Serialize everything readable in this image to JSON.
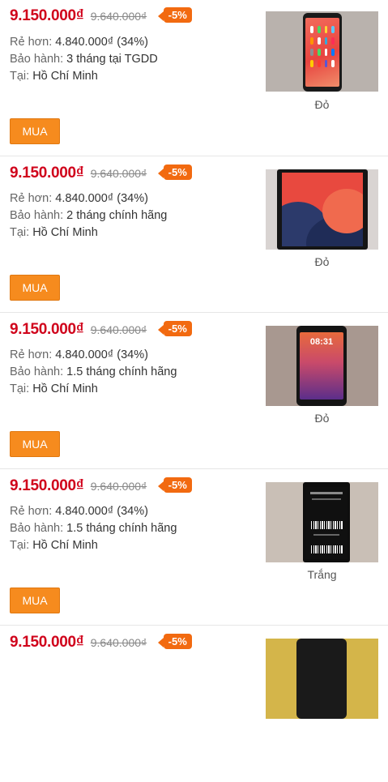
{
  "labels": {
    "cheaper": "Rẻ hơn:",
    "warranty": "Bảo hành:",
    "location": "Tại:",
    "buy": "MUA"
  },
  "colors": {
    "price": "#d0021b",
    "discount_badge": "#f26a10",
    "buy_button": "#f68b1e"
  },
  "items": [
    {
      "price": "9.150.000₫",
      "old_price": "9.640.000₫",
      "discount": "-5%",
      "cheaper_value": "4.840.000₫ (34%)",
      "warranty_value": "3 tháng tại TGDD",
      "location_value": "Hồ Chí Minh",
      "color": "Đỏ"
    },
    {
      "price": "9.150.000₫",
      "old_price": "9.640.000₫",
      "discount": "-5%",
      "cheaper_value": "4.840.000₫ (34%)",
      "warranty_value": "2 tháng chính hãng",
      "location_value": "Hồ Chí Minh",
      "color": "Đỏ"
    },
    {
      "price": "9.150.000₫",
      "old_price": "9.640.000₫",
      "discount": "-5%",
      "cheaper_value": "4.840.000₫ (34%)",
      "warranty_value": "1.5 tháng chính hãng",
      "location_value": "Hồ Chí Minh",
      "color": "Đỏ"
    },
    {
      "price": "9.150.000₫",
      "old_price": "9.640.000₫",
      "discount": "-5%",
      "cheaper_value": "4.840.000₫ (34%)",
      "warranty_value": "1.5 tháng chính hãng",
      "location_value": "Hồ Chí Minh",
      "color": "Trắng"
    },
    {
      "price": "9.150.000₫",
      "old_price": "9.640.000₫",
      "discount": "-5%"
    }
  ]
}
